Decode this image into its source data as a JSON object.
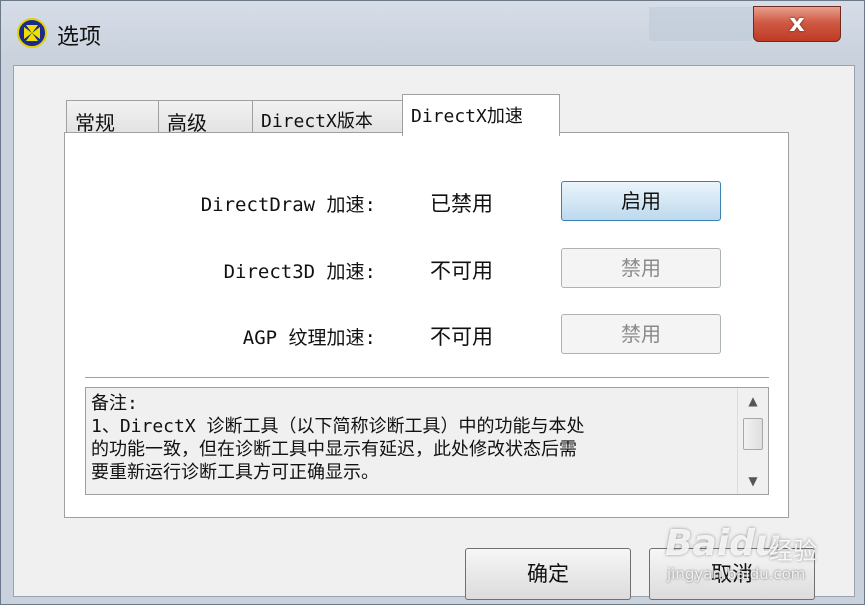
{
  "window": {
    "title": "选项",
    "close_glyph": "x"
  },
  "tabs": [
    {
      "label": "常规",
      "active": false
    },
    {
      "label": "高级",
      "active": false
    },
    {
      "label": "DirectX版本",
      "active": false
    },
    {
      "label": "DirectX加速",
      "active": true
    }
  ],
  "accel_rows": [
    {
      "label": "DirectDraw 加速:",
      "status": "已禁用",
      "button": "启用",
      "button_enabled": true
    },
    {
      "label": "Direct3D 加速:",
      "status": "不可用",
      "button": "禁用",
      "button_enabled": false
    },
    {
      "label": "AGP 纹理加速:",
      "status": "不可用",
      "button": "禁用",
      "button_enabled": false
    }
  ],
  "notes": {
    "lines": [
      "备注:",
      "1、DirectX 诊断工具（以下简称诊断工具）中的功能与本处",
      "的功能一致，但在诊断工具中显示有延迟，此处修改状态后需",
      "要重新运行诊断工具方可正确显示。"
    ]
  },
  "buttons": {
    "ok": "确定",
    "cancel": "取消"
  },
  "watermark": {
    "logo": "Baidu",
    "cn": "经验",
    "url": "jingyan.baidu.com"
  },
  "colors": {
    "close_button": "#cf5a44",
    "enabled_button_border": "#3c7fb1",
    "app_icon": "#1b2a8c"
  }
}
